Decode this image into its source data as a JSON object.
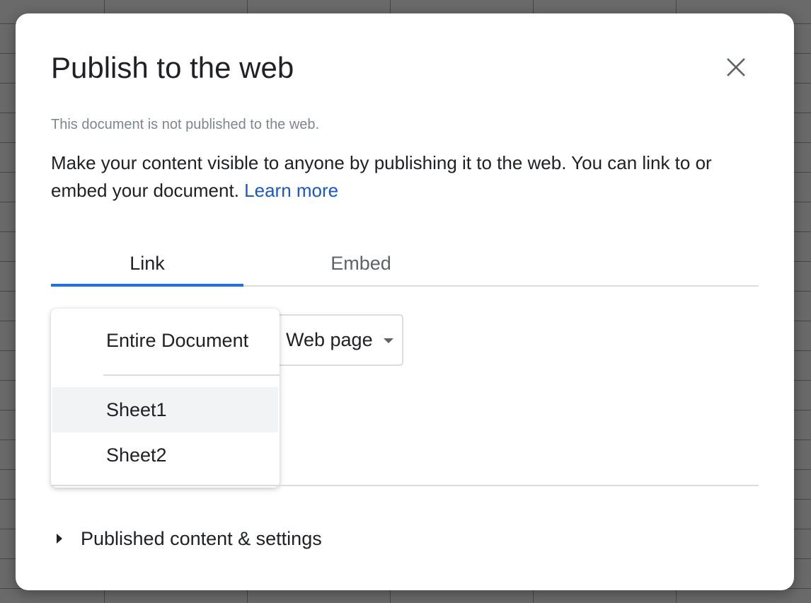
{
  "dialog": {
    "title": "Publish to the web",
    "status": "This document is not published to the web.",
    "description": "Make your content visible to anyone by publishing it to the web. You can link to or embed your document.",
    "learn_more": "Learn more"
  },
  "tabs": [
    {
      "label": "Link",
      "active": true
    },
    {
      "label": "Embed",
      "active": false
    }
  ],
  "format_select": {
    "value": "Web page"
  },
  "sheet_menu": {
    "items": [
      {
        "label": "Entire Document"
      },
      {
        "label": "Sheet1",
        "highlighted": true
      },
      {
        "label": "Sheet2"
      }
    ]
  },
  "published_settings": {
    "label": "Published content & settings"
  },
  "icons": {
    "close": "close-icon",
    "expand": "triangle-right-icon",
    "dropdown": "caret-down-icon"
  },
  "colors": {
    "accent": "#1a73e8",
    "link": "#1a57c8",
    "menu_highlight": "#f1f3f4"
  }
}
